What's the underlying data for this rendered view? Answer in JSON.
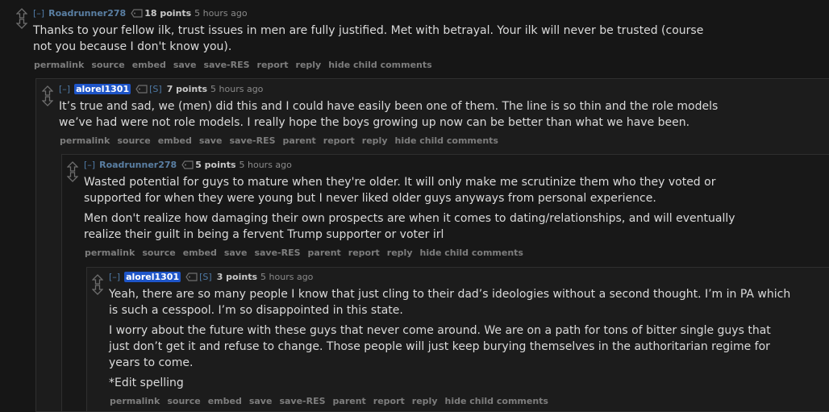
{
  "comments": [
    {
      "expand": "[–]",
      "author": "Roadrunner278",
      "is_op": false,
      "submitter": "",
      "points": "18 points",
      "time": "5 hours ago",
      "paragraphs": [
        "Thanks to your fellow ilk, trust issues in men are fully justified. Met with betrayal. Your ilk will never be trusted (course not you because I don't know you)."
      ],
      "buttons": [
        "permalink",
        "source",
        "embed",
        "save",
        "save-RES",
        "report",
        "reply",
        "hide child comments"
      ]
    },
    {
      "expand": "[–]",
      "author": "alorel1301",
      "is_op": true,
      "submitter": "[S]",
      "points": "7 points",
      "time": "5 hours ago",
      "paragraphs": [
        "It’s true and sad, we (men) did this and I could have easily been one of them. The line is so thin and the role models we’ve had were not role models. I really hope the boys growing up now can be better than what we have been."
      ],
      "buttons": [
        "permalink",
        "source",
        "embed",
        "save",
        "save-RES",
        "parent",
        "report",
        "reply",
        "hide child comments"
      ]
    },
    {
      "expand": "[–]",
      "author": "Roadrunner278",
      "is_op": false,
      "submitter": "",
      "points": "5 points",
      "time": "5 hours ago",
      "paragraphs": [
        "Wasted potential for guys to mature when they're older. It will only make me scrutinize them who they voted or supported for when they were young but I never liked older guys anyways from personal experience.",
        "Men don't realize how damaging their own prospects are when it comes to dating/relationships, and will eventually realize their guilt in being a fervent Trump supporter or voter irl"
      ],
      "buttons": [
        "permalink",
        "source",
        "embed",
        "save",
        "save-RES",
        "parent",
        "report",
        "reply",
        "hide child comments"
      ]
    },
    {
      "expand": "[–]",
      "author": "alorel1301",
      "is_op": true,
      "submitter": "[S]",
      "points": "3 points",
      "time": "5 hours ago",
      "paragraphs": [
        "Yeah, there are so many people I know that just cling to their dad’s ideologies without a second thought. I’m in PA which is such a cesspool. I’m so disappointed in this state.",
        "I worry about the future with these guys that never come around. We are on a path for tons of bitter single guys that just don’t get it and refuse to change. Those people will just keep burying themselves in the authoritarian regime for years to come.",
        "*Edit spelling"
      ],
      "buttons": [
        "permalink",
        "source",
        "embed",
        "save",
        "save-RES",
        "parent",
        "report",
        "reply",
        "hide child comments"
      ]
    }
  ]
}
